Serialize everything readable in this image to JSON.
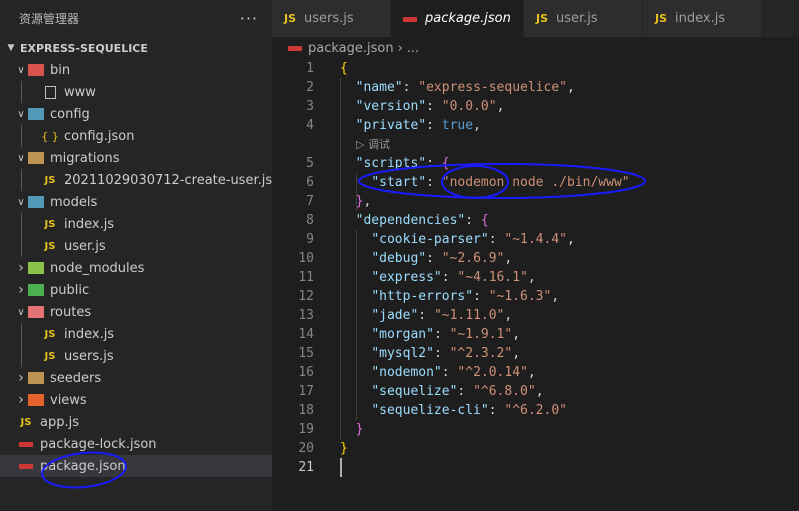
{
  "sidebar": {
    "title": "资源管理器",
    "more": "···",
    "section": "EXPRESS-SEQUELICE",
    "tree": [
      {
        "label": "bin",
        "kind": "folder",
        "color": "#d9534f",
        "depth": 1,
        "open": true
      },
      {
        "label": "www",
        "kind": "file",
        "depth": 2
      },
      {
        "label": "config",
        "kind": "folder",
        "color": "#519aba",
        "depth": 1,
        "open": true
      },
      {
        "label": "config.json",
        "kind": "json",
        "depth": 2
      },
      {
        "label": "migrations",
        "kind": "folder",
        "color": "#c09553",
        "depth": 1,
        "open": true
      },
      {
        "label": "20211029030712-create-user.js",
        "kind": "js",
        "depth": 2
      },
      {
        "label": "models",
        "kind": "folder",
        "color": "#519aba",
        "depth": 1,
        "open": true
      },
      {
        "label": "index.js",
        "kind": "js",
        "depth": 2
      },
      {
        "label": "user.js",
        "kind": "js",
        "depth": 2
      },
      {
        "label": "node_modules",
        "kind": "folder",
        "color": "#8bc34a",
        "depth": 1,
        "open": false
      },
      {
        "label": "public",
        "kind": "folder",
        "color": "#4caf50",
        "depth": 1,
        "open": false
      },
      {
        "label": "routes",
        "kind": "folder",
        "color": "#e57373",
        "depth": 1,
        "open": true
      },
      {
        "label": "index.js",
        "kind": "js",
        "depth": 2
      },
      {
        "label": "users.js",
        "kind": "js",
        "depth": 2
      },
      {
        "label": "seeders",
        "kind": "folder",
        "color": "#c09553",
        "depth": 1,
        "open": false
      },
      {
        "label": "views",
        "kind": "folder",
        "color": "#e5622d",
        "depth": 1,
        "open": false
      },
      {
        "label": "app.js",
        "kind": "js",
        "depth": 1
      },
      {
        "label": "package-lock.json",
        "kind": "npm",
        "depth": 1
      },
      {
        "label": "package.json",
        "kind": "npm",
        "depth": 1,
        "selected": true
      }
    ]
  },
  "tabs": [
    {
      "label": "users.js",
      "icon": "JS",
      "active": false
    },
    {
      "label": "package.json",
      "icon": "npm",
      "active": true,
      "close": "✕"
    },
    {
      "label": "user.js",
      "icon": "JS",
      "active": false
    },
    {
      "label": "index.js",
      "icon": "JS",
      "active": false
    }
  ],
  "breadcrumb": {
    "file": "package.json",
    "sep": "›",
    "rest": "..."
  },
  "code_lens": "▷ 调试",
  "editor_lines": [
    {
      "n": "1",
      "tokens": [
        [
          "b",
          "{"
        ]
      ]
    },
    {
      "n": "2",
      "tokens": [
        [
          "p",
          "  "
        ],
        [
          "k",
          "\"name\""
        ],
        [
          "p",
          ": "
        ],
        [
          "s",
          "\"express-sequelice\""
        ],
        [
          "p",
          ","
        ]
      ]
    },
    {
      "n": "3",
      "tokens": [
        [
          "p",
          "  "
        ],
        [
          "k",
          "\"version\""
        ],
        [
          "p",
          ": "
        ],
        [
          "s",
          "\"0.0.0\""
        ],
        [
          "p",
          ","
        ]
      ]
    },
    {
      "n": "4",
      "tokens": [
        [
          "p",
          "  "
        ],
        [
          "k",
          "\"private\""
        ],
        [
          "p",
          ": "
        ],
        [
          "bool",
          "true"
        ],
        [
          "p",
          ","
        ]
      ]
    },
    {
      "n": "5",
      "tokens": [
        [
          "p",
          "  "
        ],
        [
          "k",
          "\"scripts\""
        ],
        [
          "p",
          ": "
        ],
        [
          "b2",
          "{"
        ]
      ]
    },
    {
      "n": "6",
      "tokens": [
        [
          "p",
          "    "
        ],
        [
          "k",
          "\"start\""
        ],
        [
          "p",
          ": "
        ],
        [
          "s",
          "\"nodemon node ./bin/www\""
        ]
      ]
    },
    {
      "n": "7",
      "tokens": [
        [
          "p",
          "  "
        ],
        [
          "b2",
          "}"
        ],
        [
          "p",
          ","
        ]
      ]
    },
    {
      "n": "8",
      "tokens": [
        [
          "p",
          "  "
        ],
        [
          "k",
          "\"dependencies\""
        ],
        [
          "p",
          ": "
        ],
        [
          "b2",
          "{"
        ]
      ]
    },
    {
      "n": "9",
      "tokens": [
        [
          "p",
          "    "
        ],
        [
          "k",
          "\"cookie-parser\""
        ],
        [
          "p",
          ": "
        ],
        [
          "s",
          "\"~1.4.4\""
        ],
        [
          "p",
          ","
        ]
      ]
    },
    {
      "n": "10",
      "tokens": [
        [
          "p",
          "    "
        ],
        [
          "k",
          "\"debug\""
        ],
        [
          "p",
          ": "
        ],
        [
          "s",
          "\"~2.6.9\""
        ],
        [
          "p",
          ","
        ]
      ]
    },
    {
      "n": "11",
      "tokens": [
        [
          "p",
          "    "
        ],
        [
          "k",
          "\"express\""
        ],
        [
          "p",
          ": "
        ],
        [
          "s",
          "\"~4.16.1\""
        ],
        [
          "p",
          ","
        ]
      ]
    },
    {
      "n": "12",
      "tokens": [
        [
          "p",
          "    "
        ],
        [
          "k",
          "\"http-errors\""
        ],
        [
          "p",
          ": "
        ],
        [
          "s",
          "\"~1.6.3\""
        ],
        [
          "p",
          ","
        ]
      ]
    },
    {
      "n": "13",
      "tokens": [
        [
          "p",
          "    "
        ],
        [
          "k",
          "\"jade\""
        ],
        [
          "p",
          ": "
        ],
        [
          "s",
          "\"~1.11.0\""
        ],
        [
          "p",
          ","
        ]
      ]
    },
    {
      "n": "14",
      "tokens": [
        [
          "p",
          "    "
        ],
        [
          "k",
          "\"morgan\""
        ],
        [
          "p",
          ": "
        ],
        [
          "s",
          "\"~1.9.1\""
        ],
        [
          "p",
          ","
        ]
      ]
    },
    {
      "n": "15",
      "tokens": [
        [
          "p",
          "    "
        ],
        [
          "k",
          "\"mysql2\""
        ],
        [
          "p",
          ": "
        ],
        [
          "s",
          "\"^2.3.2\""
        ],
        [
          "p",
          ","
        ]
      ]
    },
    {
      "n": "16",
      "tokens": [
        [
          "p",
          "    "
        ],
        [
          "k",
          "\"nodemon\""
        ],
        [
          "p",
          ": "
        ],
        [
          "s",
          "\"^2.0.14\""
        ],
        [
          "p",
          ","
        ]
      ]
    },
    {
      "n": "17",
      "tokens": [
        [
          "p",
          "    "
        ],
        [
          "k",
          "\"sequelize\""
        ],
        [
          "p",
          ": "
        ],
        [
          "s",
          "\"^6.8.0\""
        ],
        [
          "p",
          ","
        ]
      ]
    },
    {
      "n": "18",
      "tokens": [
        [
          "p",
          "    "
        ],
        [
          "k",
          "\"sequelize-cli\""
        ],
        [
          "p",
          ": "
        ],
        [
          "s",
          "\"^6.2.0\""
        ]
      ]
    },
    {
      "n": "19",
      "tokens": [
        [
          "p",
          "  "
        ],
        [
          "b2",
          "}"
        ]
      ]
    },
    {
      "n": "20",
      "tokens": [
        [
          "b",
          "}"
        ]
      ]
    },
    {
      "n": "21",
      "tokens": []
    }
  ],
  "colors": {
    "annotation": "#1a1aff",
    "accent": "#007acc"
  }
}
